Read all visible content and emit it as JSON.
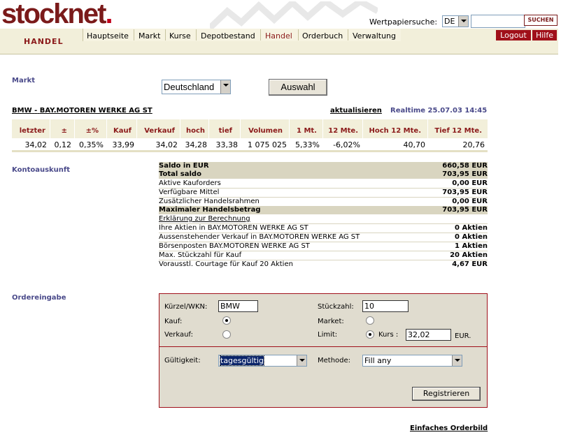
{
  "header": {
    "logo_text": "stocknet",
    "logo_dot": ".",
    "search_label": "Wertpapiersuche:",
    "country_value": "DE",
    "search_value": "",
    "search_button": "SUCHEN"
  },
  "nav": {
    "section": "HANDEL",
    "items": [
      "Hauptseite",
      "Markt",
      "Kurse",
      "Depotbestand",
      "Handel",
      "Orderbuch",
      "Verwaltung"
    ],
    "active": "Handel",
    "logout": "Logout",
    "help": "Hilfe"
  },
  "market": {
    "label": "Markt",
    "selected": "Deutschland",
    "button": "Auswahl"
  },
  "stock": {
    "symbol": "BMW",
    "separator": "-",
    "name": "BAY.MOTOREN WERKE AG ST",
    "refresh": "aktualisieren",
    "realtime": "Realtime 25.07.03 14:45"
  },
  "quote": {
    "headers": [
      "letzter",
      "±",
      "±%",
      "Kauf",
      "Verkauf",
      "hoch",
      "tief",
      "Volumen",
      "1 Mt.",
      "12 Mte.",
      "Hoch 12 Mte.",
      "Tief 12 Mte."
    ],
    "values": [
      "34,02",
      "0,12",
      "0,35%",
      "33,99",
      "34,02",
      "34,28",
      "33,38",
      "1 075 025",
      "5,33%",
      "-6,02%",
      "40,70",
      "20,76"
    ]
  },
  "account": {
    "label": "Kontoauskunft",
    "rows": [
      {
        "label": "Saldo in EUR",
        "value": "660,58 EUR"
      },
      {
        "label": "Total saldo",
        "value": "703,95 EUR"
      },
      {
        "label": "Aktive Kauforders",
        "value": "0,00 EUR"
      },
      {
        "label": "Verfügbare Mittel",
        "value": "703,95 EUR"
      },
      {
        "label": "Zusätzlicher Handelsrahmen",
        "value": "0,00 EUR"
      },
      {
        "label": "Maximaler Handelsbetrag",
        "value": "703,95 EUR"
      },
      {
        "label": "Erklärung zur Berechnung",
        "value": ""
      },
      {
        "label": "Ihre Aktien in BAY.MOTOREN WERKE AG ST",
        "value": "0 Aktien"
      },
      {
        "label": "Aussenstehender Verkauf in BAY.MOTOREN WERKE AG ST",
        "value": "0 Aktien"
      },
      {
        "label": "Börsenposten BAY.MOTOREN WERKE AG ST",
        "value": "1 Aktien"
      },
      {
        "label": "Max. Stückzahl für Kauf",
        "value": "20 Aktien"
      },
      {
        "label": "Vorausstl. Courtage für Kauf 20 Aktien",
        "value": "4,67 EUR"
      }
    ]
  },
  "order": {
    "label": "Ordereingabe",
    "symbol_label": "Kürzel/WKN:",
    "symbol_value": "BMW",
    "qty_label": "Stückzahl:",
    "qty_value": "10",
    "buy_label": "Kauf:",
    "sell_label": "Verkauf:",
    "market_label": "Market:",
    "limit_label": "Limit:",
    "price_label": "Kurs :",
    "price_value": "32,02",
    "currency": "EUR.",
    "validity_label": "Gültigkeit:",
    "validity_value": "tagesgültig",
    "method_label": "Methode:",
    "method_value": "Fill any",
    "register_button": "Registrieren"
  },
  "footer": {
    "simple_link": "Einfaches Orderbild"
  }
}
